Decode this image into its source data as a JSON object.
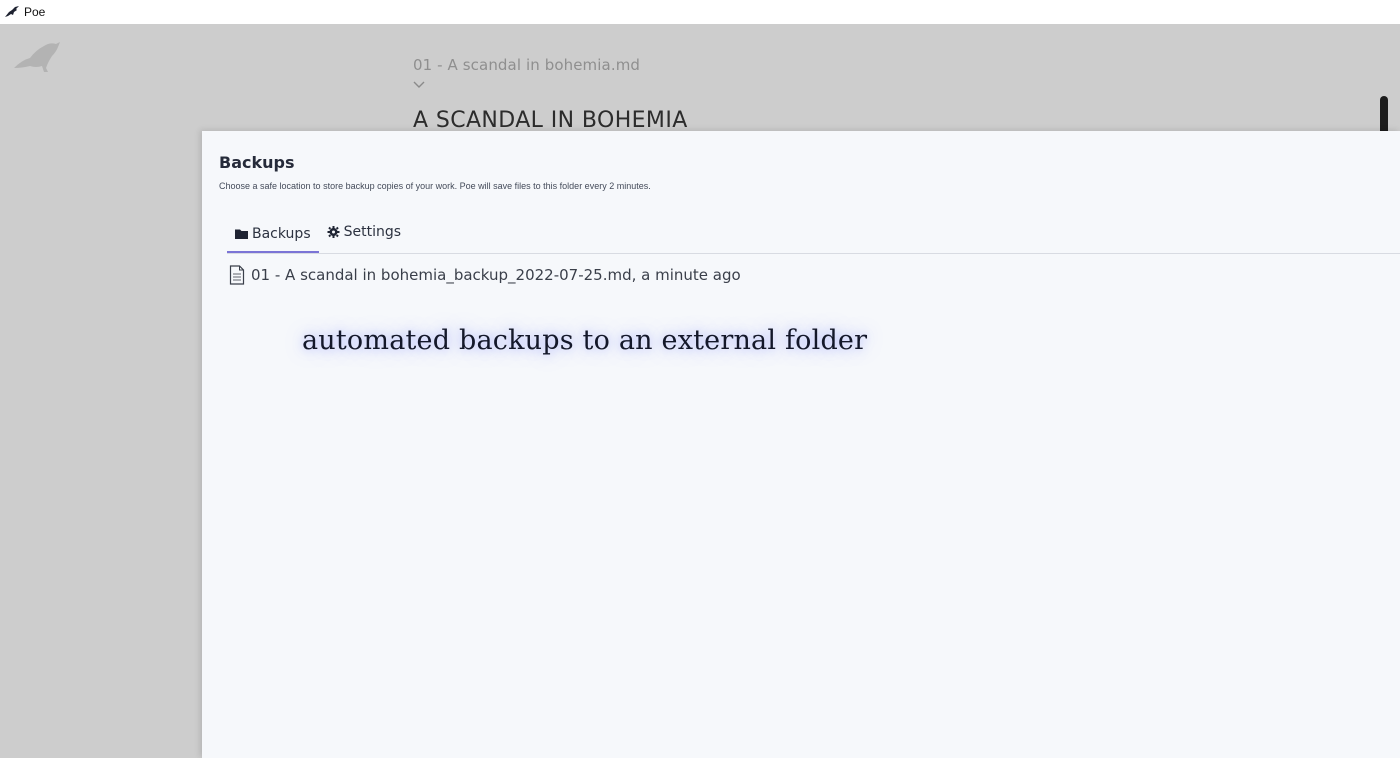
{
  "window": {
    "title": "Poe",
    "icon": "raven-icon"
  },
  "editor": {
    "filename": "01 - A scandal in bohemia.md",
    "heading": "A SCANDAL IN BOHEMIA",
    "logo_icon": "raven-logo-icon"
  },
  "backups_panel": {
    "title": "Backups",
    "description": "Choose a safe location to store backup copies of your work. Poe will save files to this folder every 2 minutes.",
    "tabs": [
      {
        "label": "Backups",
        "icon": "folder-icon",
        "active": true
      },
      {
        "label": "Settings",
        "icon": "gear-icon",
        "active": false
      }
    ],
    "files": [
      {
        "label": "01 - A scandal in bohemia_backup_2022-07-25.md, a minute ago",
        "icon": "file-icon"
      }
    ]
  },
  "caption": "automated backups to an external folder",
  "colors": {
    "background": "#cdcdcd",
    "panel": "#f6f8fb",
    "tab_accent": "#7b74d6",
    "caption_glow": "#828cff"
  }
}
